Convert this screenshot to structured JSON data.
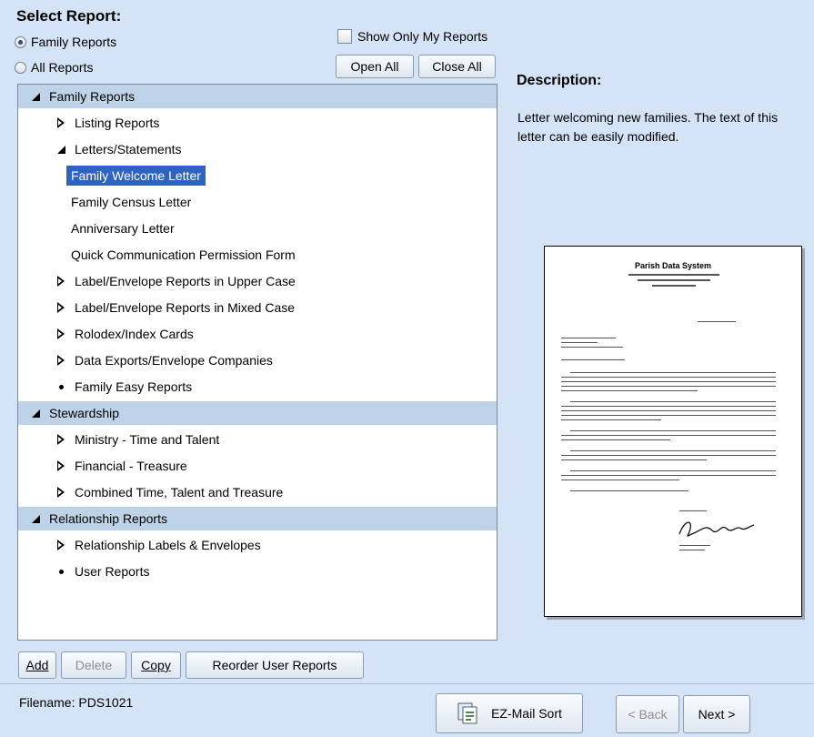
{
  "header": {
    "title": "Select Report:"
  },
  "filters": {
    "family_reports_label": "Family Reports",
    "all_reports_label": "All Reports",
    "show_only_mine_label": "Show Only My Reports",
    "open_all_label": "Open All",
    "close_all_label": "Close All"
  },
  "tree": [
    {
      "label": "Family Reports",
      "level": 0,
      "type": "group"
    },
    {
      "label": "Listing Reports",
      "level": 1,
      "type": "collapsed"
    },
    {
      "label": "Letters/Statements",
      "level": 1,
      "type": "expanded"
    },
    {
      "label": "Family Welcome Letter",
      "level": 2,
      "type": "leaf",
      "selected": true
    },
    {
      "label": "Family Census Letter",
      "level": 2,
      "type": "leaf"
    },
    {
      "label": "Anniversary Letter",
      "level": 2,
      "type": "leaf"
    },
    {
      "label": "Quick Communication Permission Form",
      "level": 2,
      "type": "leaf"
    },
    {
      "label": "Label/Envelope Reports in Upper Case",
      "level": 1,
      "type": "collapsed"
    },
    {
      "label": "Label/Envelope Reports in Mixed Case",
      "level": 1,
      "type": "collapsed"
    },
    {
      "label": "Rolodex/Index Cards",
      "level": 1,
      "type": "collapsed"
    },
    {
      "label": "Data Exports/Envelope Companies",
      "level": 1,
      "type": "collapsed"
    },
    {
      "label": "Family Easy Reports",
      "level": 1,
      "type": "bullet"
    },
    {
      "label": "Stewardship",
      "level": 0,
      "type": "group"
    },
    {
      "label": "Ministry - Time and Talent",
      "level": 1,
      "type": "collapsed"
    },
    {
      "label": "Financial - Treasure",
      "level": 1,
      "type": "collapsed"
    },
    {
      "label": "Combined Time, Talent and Treasure",
      "level": 1,
      "type": "collapsed"
    },
    {
      "label": "Relationship Reports",
      "level": 0,
      "type": "group"
    },
    {
      "label": "Relationship Labels & Envelopes",
      "level": 1,
      "type": "collapsed"
    },
    {
      "label": "User Reports",
      "level": 1,
      "type": "bullet"
    }
  ],
  "description": {
    "title": "Description:",
    "text": "Letter welcoming new families.  The text of this letter can be easily modified."
  },
  "preview": {
    "heading": "Parish Data System"
  },
  "actions": {
    "add_label": "Add",
    "delete_label": "Delete",
    "copy_label": "Copy",
    "reorder_label": "Reorder User Reports"
  },
  "footer": {
    "filename": "Filename: PDS1021",
    "ezmail_label": "EZ-Mail Sort",
    "back_label": "< Back",
    "next_label": "Next >"
  }
}
